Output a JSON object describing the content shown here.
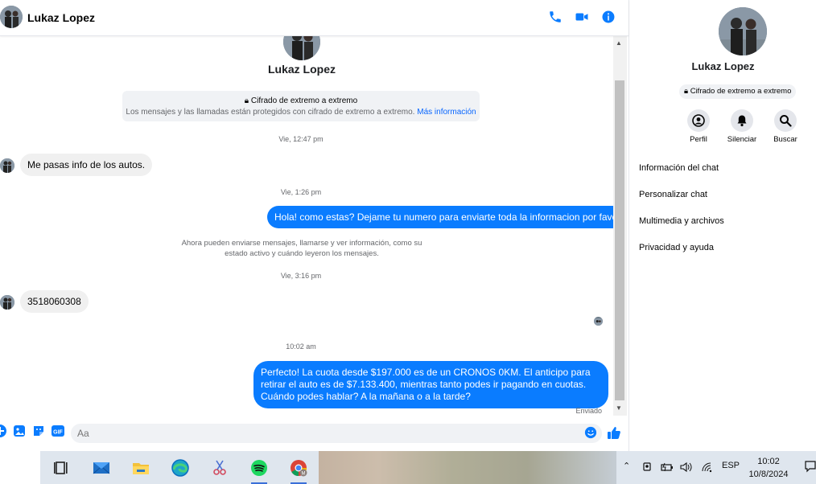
{
  "header": {
    "contact_name": "Lukaz Lopez"
  },
  "conversation": {
    "contact_name": "Lukaz Lopez",
    "encryption_title": "Cifrado de extremo a extremo",
    "encryption_desc": "Los mensajes y las llamadas están protegidos con cifrado de extremo a extremo.",
    "encryption_link": "Más información",
    "timestamps": [
      "Vie, 12:47 pm",
      "Vie, 1:26 pm",
      "Vie, 3:16 pm",
      "10:02 am"
    ],
    "messages": [
      {
        "from": "contact",
        "text": "Me pasas info de los autos."
      },
      {
        "from": "me",
        "text": "Hola! como estas? Dejame tu numero para enviarte toda la informacion por favor!"
      },
      {
        "from": "contact",
        "text": "3518060308"
      },
      {
        "from": "me",
        "text": "Perfecto! La cuota desde $197.000 es de un CRONOS 0KM. El anticipo para retirar el auto es de $7.133.400, mientras tanto podes ir pagando en cuotas. Cuándo podes hablar? A la mañana o a la tarde?"
      }
    ],
    "system_message": "Ahora pueden enviarse mensajes, llamarse y ver información, como su estado activo y cuándo leyeron los mensajes.",
    "status": "Enviado"
  },
  "composer": {
    "placeholder": "Aa"
  },
  "panel": {
    "name": "Lukaz Lopez",
    "encryption_badge": "Cifrado de extremo a extremo",
    "actions": [
      "Perfil",
      "Silenciar",
      "Buscar"
    ],
    "menu": [
      "Información del chat",
      "Personalizar chat",
      "Multimedia y archivos",
      "Privacidad y ayuda"
    ]
  },
  "taskbar": {
    "language": "ESP",
    "time": "10:02",
    "date": "10/8/2024"
  },
  "colors": {
    "accent": "#0a7cff",
    "link": "#0866ff",
    "bubble_in": "#f0f0f0"
  }
}
